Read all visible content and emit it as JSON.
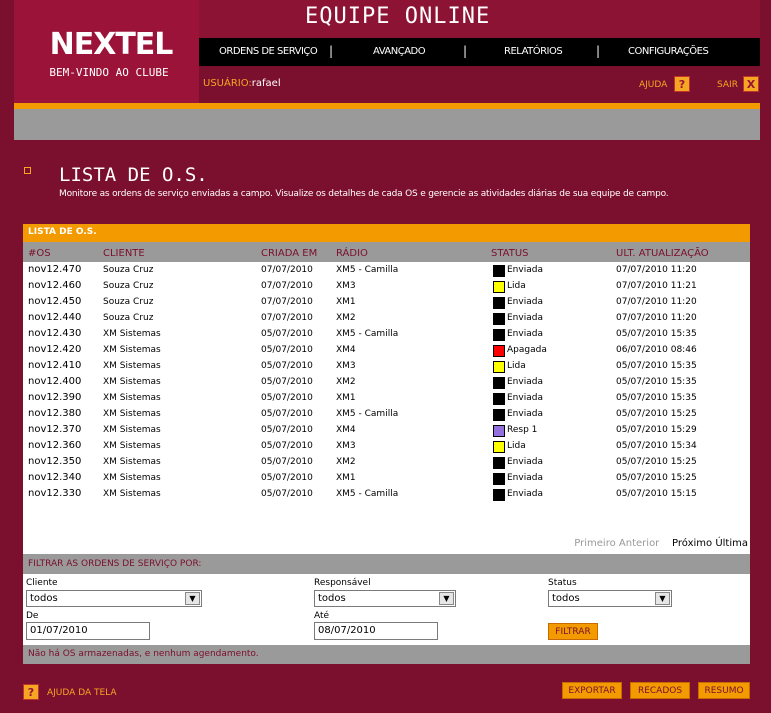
{
  "header": {
    "logo": "NEXTEL",
    "logo_tagline": "BEM-VINDO AO CLUBE",
    "app_title": "EQUIPE ONLINE",
    "nav": [
      "ORDENS DE SERVIÇO",
      "AVANÇADO",
      "RELATÓRIOS",
      "CONFIGURAÇÕES"
    ],
    "nav_separator": "|",
    "user_label": "USUÁRIO:",
    "user_name": "rafael",
    "help_label": "AJUDA",
    "help_icon_glyph": "?",
    "exit_label": "SAIR",
    "exit_icon_glyph": "X"
  },
  "page": {
    "title": "LISTA DE O.S.",
    "description": "Monitore as ordens de serviço enviadas a campo. Visualize os detalhes de cada OS e gerencie as atividades diárias de sua equipe de campo."
  },
  "list": {
    "panel_title": "LISTA DE O.S.",
    "columns": [
      "#OS",
      "CLIENTE",
      "CRIADA EM",
      "RÁDIO",
      "STATUS",
      "ULT. ATUALIZAÇÃO"
    ],
    "rows": [
      {
        "os": "nov12.470",
        "cliente": "Souza Cruz",
        "criada": "07/07/2010",
        "radio": "XM5 - Camilla",
        "status": "Enviada",
        "status_color": "#000000",
        "ult": "07/07/2010 11:20"
      },
      {
        "os": "nov12.460",
        "cliente": "Souza Cruz",
        "criada": "07/07/2010",
        "radio": "XM3",
        "status": "Lida",
        "status_color": "#ffff00",
        "ult": "07/07/2010 11:21"
      },
      {
        "os": "nov12.450",
        "cliente": "Souza Cruz",
        "criada": "07/07/2010",
        "radio": "XM1",
        "status": "Enviada",
        "status_color": "#000000",
        "ult": "07/07/2010 11:20"
      },
      {
        "os": "nov12.440",
        "cliente": "Souza Cruz",
        "criada": "07/07/2010",
        "radio": "XM2",
        "status": "Enviada",
        "status_color": "#000000",
        "ult": "07/07/2010 11:20"
      },
      {
        "os": "nov12.430",
        "cliente": "XM Sistemas",
        "criada": "05/07/2010",
        "radio": "XM5 - Camilla",
        "status": "Enviada",
        "status_color": "#000000",
        "ult": "05/07/2010 15:35"
      },
      {
        "os": "nov12.420",
        "cliente": "XM Sistemas",
        "criada": "05/07/2010",
        "radio": "XM4",
        "status": "Apagada",
        "status_color": "#ff0000",
        "ult": "06/07/2010 08:46"
      },
      {
        "os": "nov12.410",
        "cliente": "XM Sistemas",
        "criada": "05/07/2010",
        "radio": "XM3",
        "status": "Lida",
        "status_color": "#ffff00",
        "ult": "05/07/2010 15:35"
      },
      {
        "os": "nov12.400",
        "cliente": "XM Sistemas",
        "criada": "05/07/2010",
        "radio": "XM2",
        "status": "Enviada",
        "status_color": "#000000",
        "ult": "05/07/2010 15:35"
      },
      {
        "os": "nov12.390",
        "cliente": "XM Sistemas",
        "criada": "05/07/2010",
        "radio": "XM1",
        "status": "Enviada",
        "status_color": "#000000",
        "ult": "05/07/2010 15:35"
      },
      {
        "os": "nov12.380",
        "cliente": "XM Sistemas",
        "criada": "05/07/2010",
        "radio": "XM5 - Camilla",
        "status": "Enviada",
        "status_color": "#000000",
        "ult": "05/07/2010 15:25"
      },
      {
        "os": "nov12.370",
        "cliente": "XM Sistemas",
        "criada": "05/07/2010",
        "radio": "XM4",
        "status": "Resp 1",
        "status_color": "#9370db",
        "ult": "05/07/2010 15:29"
      },
      {
        "os": "nov12.360",
        "cliente": "XM Sistemas",
        "criada": "05/07/2010",
        "radio": "XM3",
        "status": "Lida",
        "status_color": "#ffff00",
        "ult": "05/07/2010 15:34"
      },
      {
        "os": "nov12.350",
        "cliente": "XM Sistemas",
        "criada": "05/07/2010",
        "radio": "XM2",
        "status": "Enviada",
        "status_color": "#000000",
        "ult": "05/07/2010 15:25"
      },
      {
        "os": "nov12.340",
        "cliente": "XM Sistemas",
        "criada": "05/07/2010",
        "radio": "XM1",
        "status": "Enviada",
        "status_color": "#000000",
        "ult": "05/07/2010 15:25"
      },
      {
        "os": "nov12.330",
        "cliente": "XM Sistemas",
        "criada": "05/07/2010",
        "radio": "XM5 - Camilla",
        "status": "Enviada",
        "status_color": "#000000",
        "ult": "05/07/2010 15:15"
      }
    ],
    "pager": {
      "first": "Primeiro",
      "prev": "Anterior",
      "next": "Próximo",
      "last": "Última"
    }
  },
  "filter": {
    "title": "FILTRAR AS ORDENS DE SERVIÇO POR:",
    "cliente_label": "Cliente",
    "cliente_value": "todos",
    "responsavel_label": "Responsável",
    "responsavel_value": "todos",
    "status_label": "Status",
    "status_value": "todos",
    "de_label": "De",
    "de_value": "01/07/2010",
    "ate_label": "Até",
    "ate_value": "08/07/2010",
    "filter_button": "FILTRAR",
    "dropdown_glyph": "▼"
  },
  "status_message": "Não há OS armazenadas, e nenhum agendamento.",
  "footer": {
    "help_icon_glyph": "?",
    "help_label": "AJUDA DA TELA",
    "buttons": [
      "EXPORTAR",
      "RECADOS",
      "RESUMO"
    ]
  },
  "colors": {
    "background": "#7b0f2e",
    "accent": "#f29a00",
    "panel_gray": "#9a9a9a"
  }
}
